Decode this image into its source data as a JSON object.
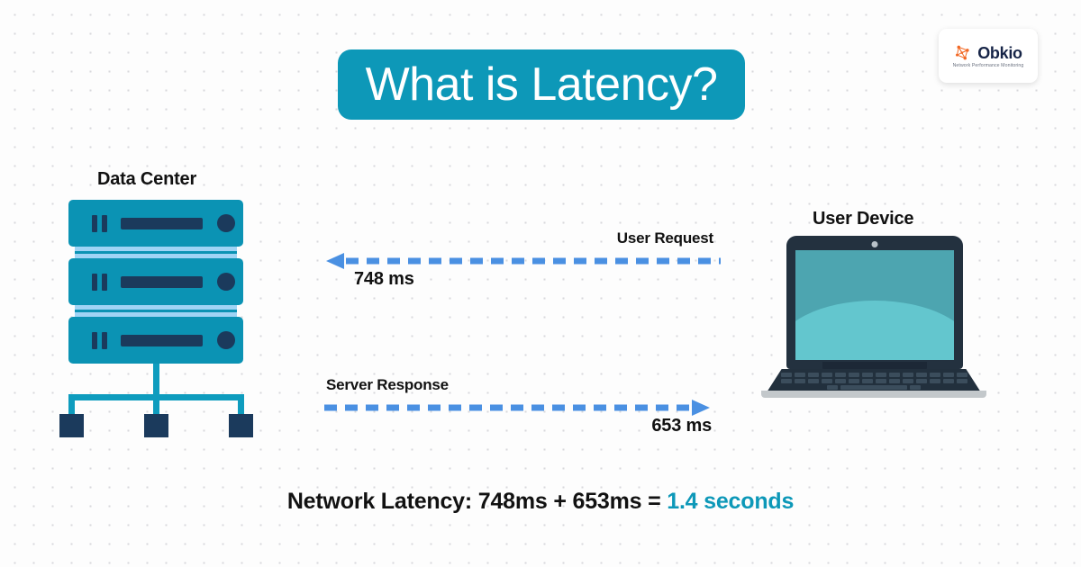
{
  "title": "What is Latency?",
  "logo": {
    "name": "Obkio",
    "tagline": "Network Performance Monitoring",
    "mark": "network-graph-icon",
    "mark_color": "#f26722"
  },
  "nodes": {
    "left_heading": "Data Center",
    "right_heading": "User Device"
  },
  "flows": [
    {
      "label": "User Request",
      "value": "748 ms",
      "direction": "left",
      "color": "#4a90e2"
    },
    {
      "label": "Server Response",
      "value": "653 ms",
      "direction": "right",
      "color": "#4a90e2"
    }
  ],
  "summary": {
    "prefix": "Network Latency: 748ms + 653ms = ",
    "total": "1.4 seconds",
    "accent_color": "#0d98b8"
  },
  "colors": {
    "title_bar": "#0d98b8",
    "server_teal": "#0b93b4",
    "server_detail": "#1b3a5c",
    "divider_blue": "#9fd4f5",
    "arrow_blue": "#4a90e2",
    "background": "#fdfdfd"
  },
  "chart_data": {
    "type": "diagram",
    "title": "What is Latency?",
    "endpoints": [
      "Data Center",
      "User Device"
    ],
    "segments": [
      {
        "name": "User Request",
        "value": 748,
        "unit": "ms",
        "direction": "user-to-datacenter"
      },
      {
        "name": "Server Response",
        "value": 653,
        "unit": "ms",
        "direction": "datacenter-to-user"
      }
    ],
    "total": {
      "label": "Network Latency",
      "value": 1.4,
      "unit": "seconds",
      "expression": "748ms + 653ms = 1.4 seconds"
    }
  }
}
